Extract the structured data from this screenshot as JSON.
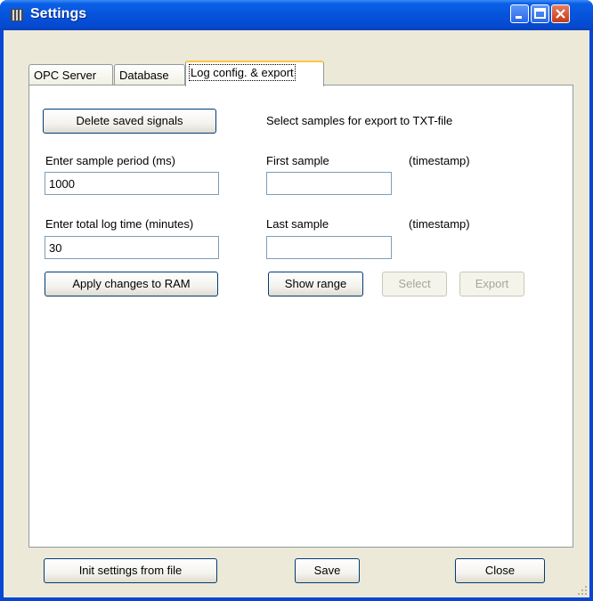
{
  "window": {
    "title": "Settings"
  },
  "tabs": [
    {
      "label": "OPC Server",
      "active": false
    },
    {
      "label": "Database",
      "active": false
    },
    {
      "label": "Log config. & export",
      "active": true
    }
  ],
  "log_tab": {
    "delete_button": "Delete saved signals",
    "export_heading": "Select samples for export to TXT-file",
    "sample_period_label": "Enter sample period (ms)",
    "sample_period_value": "1000",
    "total_log_label": "Enter total log time (minutes)",
    "total_log_value": "30",
    "apply_button": "Apply changes to RAM",
    "first_sample_label": "First sample",
    "first_sample_hint": "(timestamp)",
    "first_sample_value": "",
    "last_sample_label": "Last sample",
    "last_sample_hint": "(timestamp)",
    "last_sample_value": "",
    "show_range_button": "Show range",
    "select_button": "Select",
    "export_button": "Export"
  },
  "footer": {
    "init_button": "Init settings from file",
    "save_button": "Save",
    "close_button": "Close"
  },
  "colors": {
    "titlebar": "#0653DB",
    "window_bg": "#ECE9D8",
    "tab_highlight": "#FFC83C"
  }
}
